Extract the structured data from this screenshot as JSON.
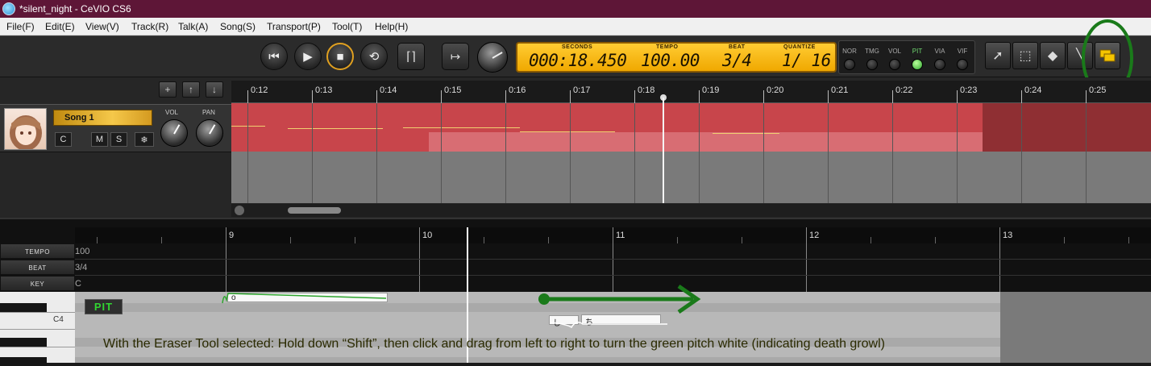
{
  "window": {
    "title": "*silent_night - CeVIO CS6"
  },
  "menu": [
    "File(F)",
    "Edit(E)",
    "View(V)",
    "Track(R)",
    "Talk(A)",
    "Song(S)",
    "Transport(P)",
    "Tool(T)",
    "Help(H)"
  ],
  "lcd": {
    "seconds_label": "SECONDS",
    "seconds": "000:18.450",
    "tempo_label": "TEMPO",
    "tempo": "100.00",
    "beat_label": "BEAT",
    "beat": "3/4",
    "quantize_label": "QUANTIZE",
    "quantize": "1/ 16"
  },
  "modes": [
    {
      "label": "NOR",
      "on": false
    },
    {
      "label": "TMG",
      "on": false
    },
    {
      "label": "VOL",
      "on": false
    },
    {
      "label": "PIT",
      "on": true
    },
    {
      "label": "VIA",
      "on": false
    },
    {
      "label": "VIF",
      "on": false
    }
  ],
  "track": {
    "name": "Song 1",
    "vol_label": "VOL",
    "pan_label": "PAN",
    "buttons": [
      "C",
      "M",
      "S",
      "❄"
    ]
  },
  "timeline": [
    "0:12",
    "0:13",
    "0:14",
    "0:15",
    "0:16",
    "0:17",
    "0:18",
    "0:19",
    "0:20",
    "0:21",
    "0:22",
    "0:23",
    "0:24",
    "0:25"
  ],
  "editor": {
    "measures": [
      "9",
      "10",
      "11",
      "12",
      "13"
    ],
    "tempo_label": "TEMPO",
    "tempo_value": "100",
    "beat_label": "BEAT",
    "beat_value": "3/4",
    "key_label": "KEY",
    "key_value": "C",
    "pit_badge": "PIT",
    "piano_c4": "C4",
    "note1_lyric": "o",
    "note2_lyric": "し",
    "note3_lyric": "ち"
  },
  "annotation": {
    "text": "With the Eraser Tool selected: Hold down “Shift”, then click and drag from left to right to turn the green pitch white (indicating death growl)",
    "color": "#1a7a1a"
  }
}
